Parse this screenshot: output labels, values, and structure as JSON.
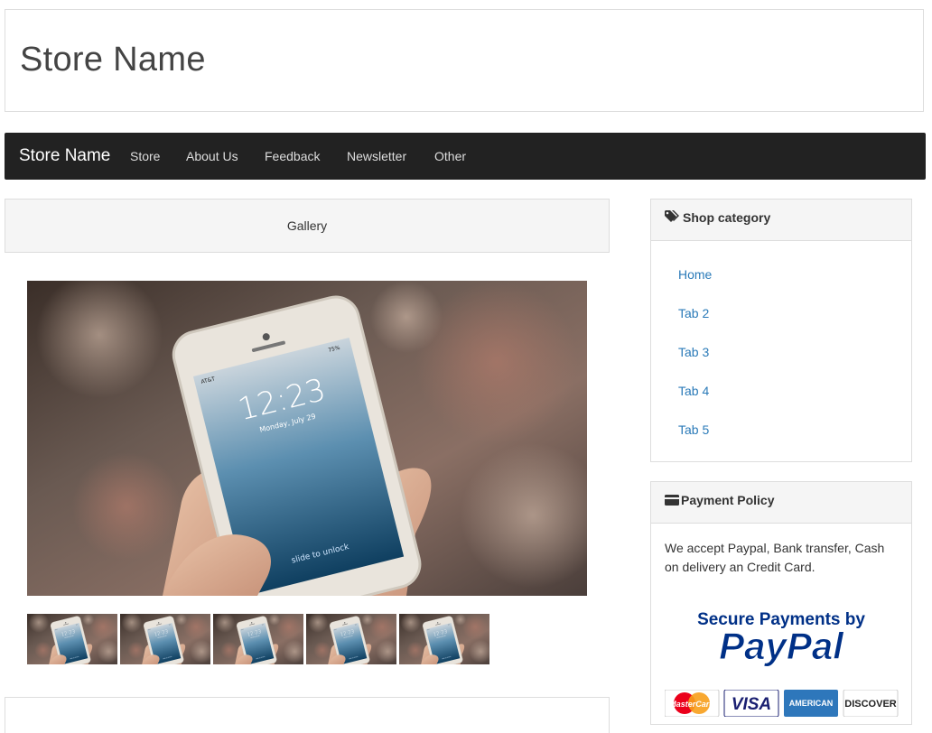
{
  "header": {
    "store_title": "Store Name"
  },
  "navbar": {
    "brand": "Store Name",
    "items": [
      "Store",
      "About Us",
      "Feedback",
      "Newsletter",
      "Other"
    ]
  },
  "gallery": {
    "heading": "Gallery",
    "phone_time": "12:23",
    "phone_date": "Monday, July 29",
    "slide_text": "slide to unlock",
    "carrier": "AT&T",
    "battery": "75%"
  },
  "sidebar": {
    "shop_category": {
      "title": "Shop category",
      "icon": "tags-icon",
      "links": [
        "Home",
        "Tab 2",
        "Tab 3",
        "Tab 4",
        "Tab 5"
      ]
    },
    "payment_policy": {
      "title": "Payment Policy",
      "icon": "credit-card-icon",
      "text": "We accept Paypal, Bank transfer, Cash on delivery an Credit Card.",
      "banner_heading": "Secure Payments by",
      "banner_brand": "PayPal",
      "cards": [
        "MasterCard",
        "VISA",
        "AMERICAN",
        "DISCOVER"
      ]
    }
  },
  "colors": {
    "navbar": "#222222",
    "link": "#2a7ab8",
    "paypal_blue": "#003087",
    "paypal_light": "#009cde"
  }
}
